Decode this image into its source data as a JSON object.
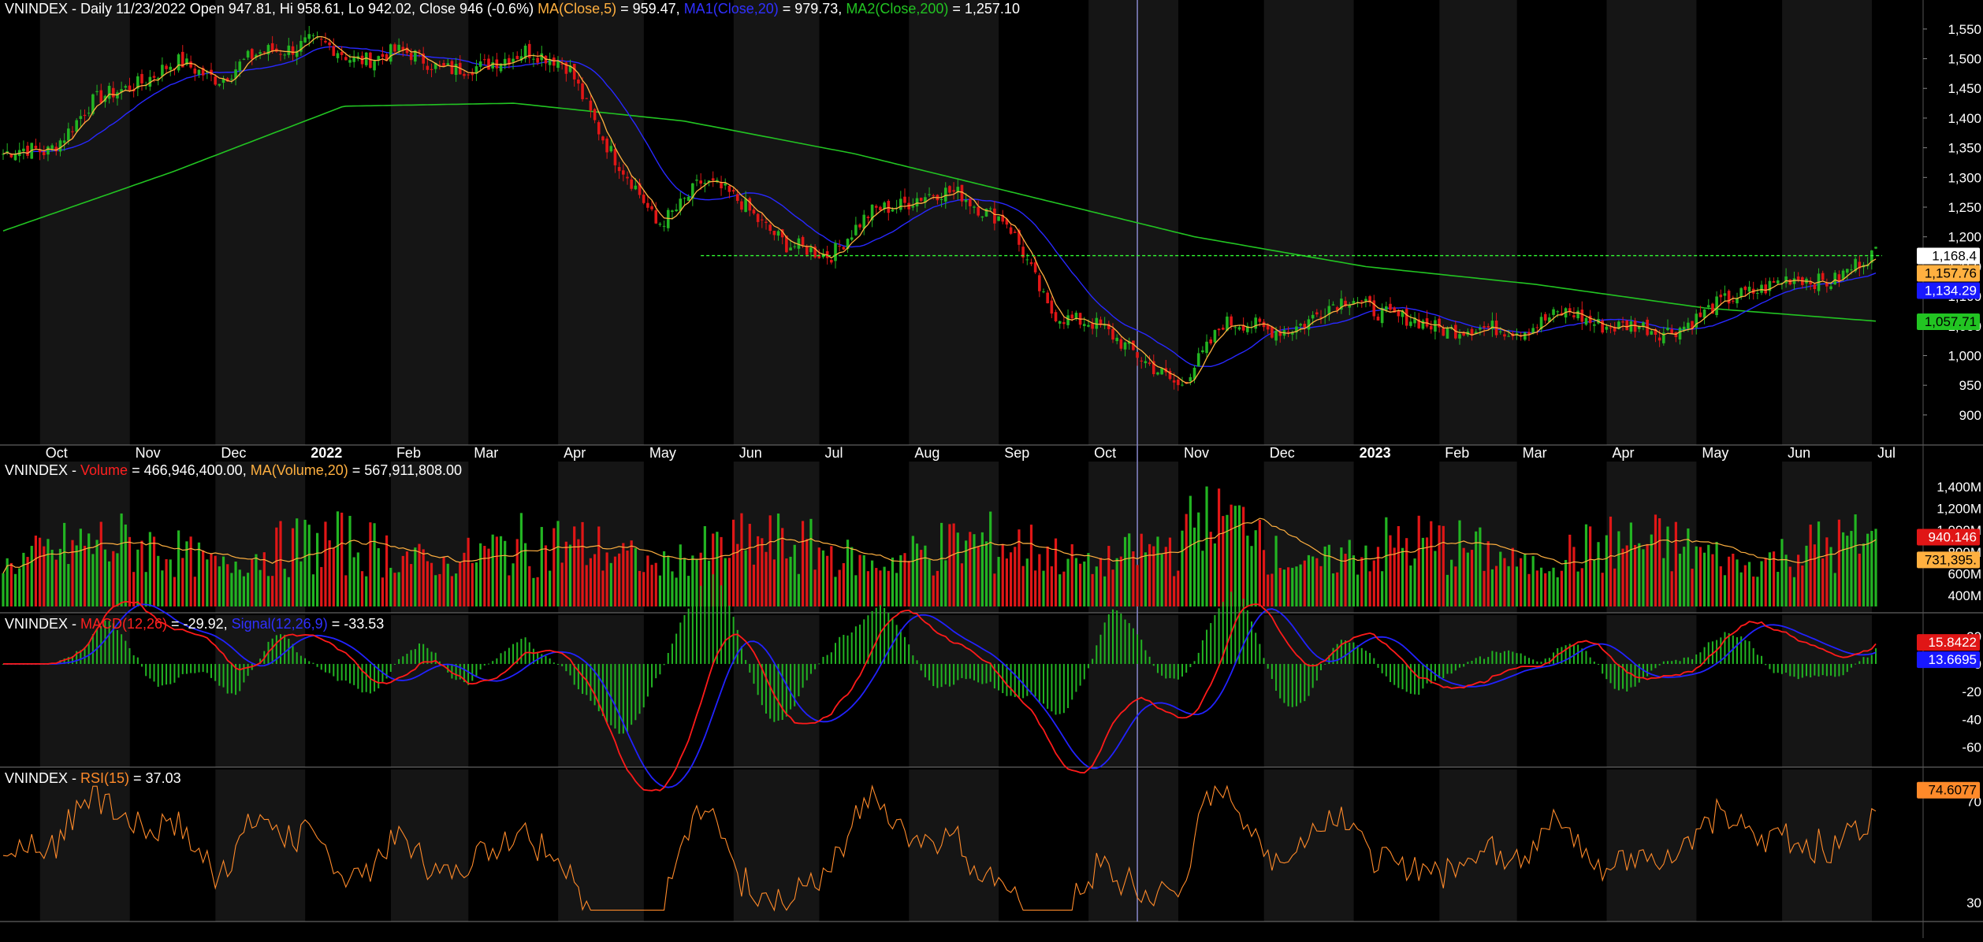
{
  "colors": {
    "background": "#000000",
    "band": "#151515",
    "up": "#22b422",
    "down": "#e01616",
    "ma5": "#ffb040",
    "ma20": "#2828ff",
    "ma200": "#22c422",
    "macd": "#ff1a1a",
    "signal": "#2222ff",
    "rsi": "#ff8a2a",
    "cursor": "#8888cc",
    "support": "#33ff33"
  },
  "header": {
    "price": {
      "prefix": "VNINDEX - Daily 11/23/2022 Open 947.81, Hi 958.61, Lo 942.02, Close 946 (-0.6%) ",
      "ma5_label": "MA(Close,5)",
      "ma5_value": " = 959.47, ",
      "ma20_label": "MA1(Close,20)",
      "ma20_value": " = 979.73, ",
      "ma200_label": "MA2(Close,200)",
      "ma200_value": " = 1,257.10"
    },
    "volume": {
      "prefix": "VNINDEX - ",
      "vol_label": "Volume",
      "vol_value": " = 466,946,400.00, ",
      "ma_label": "MA(Volume,20)",
      "ma_value": " = 567,911,808.00"
    },
    "macd": {
      "prefix": "VNINDEX - ",
      "macd_label": "MACD(12,26)",
      "macd_value": " = -29.92, ",
      "signal_label": "Signal(12,26,9)",
      "signal_value": " = -33.53"
    },
    "rsi": {
      "prefix": "VNINDEX - ",
      "rsi_label": "RSI(15)",
      "rsi_value": " = 37.03"
    }
  },
  "chart_data": [
    {
      "type": "candlestick",
      "panel": "price",
      "x_labels": [
        "Oct",
        "Nov",
        "Dec",
        "2022",
        "Feb",
        "Mar",
        "Apr",
        "May",
        "Jun",
        "Jul",
        "Aug",
        "Sep",
        "Oct",
        "Nov",
        "Dec",
        "2023",
        "Feb",
        "Mar",
        "Apr",
        "May",
        "Jun",
        "Jul"
      ],
      "y_ticks": [
        900,
        950,
        1000,
        1050,
        1100,
        1150,
        1200,
        1250,
        1300,
        1350,
        1400,
        1450,
        1500,
        1550
      ],
      "ylim": [
        860,
        1575
      ],
      "price_anchors": [
        [
          "Oct",
          1340
        ],
        [
          "Oct",
          1345
        ],
        [
          "Nov",
          1420
        ],
        [
          "Nov",
          1460
        ],
        [
          "Dec",
          1490
        ],
        [
          "Dec",
          1470
        ],
        [
          "2022",
          1510
        ],
        [
          "2022",
          1530
        ],
        [
          "Feb",
          1500
        ],
        [
          "Feb",
          1510
        ],
        [
          "Mar",
          1490
        ],
        [
          "Mar",
          1480
        ],
        [
          "Apr",
          1520
        ],
        [
          "Apr",
          1480
        ],
        [
          "May",
          1340
        ],
        [
          "May",
          1220
        ],
        [
          "Jun",
          1290
        ],
        [
          "Jun",
          1260
        ],
        [
          "Jul",
          1180
        ],
        [
          "Jul",
          1175
        ],
        [
          "Aug",
          1240
        ],
        [
          "Aug",
          1270
        ],
        [
          "Sep",
          1270
        ],
        [
          "Sep",
          1230
        ],
        [
          "Oct",
          1080
        ],
        [
          "Oct",
          1050
        ],
        [
          "Nov",
          1010
        ],
        [
          "Nov",
          940
        ],
        [
          "Dec",
          1060
        ],
        [
          "Dec",
          1040
        ],
        [
          "2023",
          1060
        ],
        [
          "2023",
          1100
        ],
        [
          "Feb",
          1060
        ],
        [
          "Feb",
          1050
        ],
        [
          "Mar",
          1040
        ],
        [
          "Mar",
          1050
        ],
        [
          "Apr",
          1070
        ],
        [
          "Apr",
          1050
        ],
        [
          "May",
          1040
        ],
        [
          "May",
          1065
        ],
        [
          "Jun",
          1110
        ],
        [
          "Jun",
          1125
        ],
        [
          "Jul",
          1130
        ],
        [
          "Jul",
          1168
        ]
      ],
      "ma200_anchors": [
        [
          "Oct",
          1210
        ],
        [
          "Dec",
          1310
        ],
        [
          "Apr",
          1420
        ],
        [
          "May",
          1425
        ],
        [
          "Aug",
          1395
        ],
        [
          "Oct",
          1340
        ],
        [
          "Nov",
          1270
        ],
        [
          "Dec",
          1200
        ],
        [
          "2023",
          1150
        ],
        [
          "Mar",
          1120
        ],
        [
          "May",
          1080
        ],
        [
          "Jul",
          1058
        ]
      ],
      "support_level": 1168.4,
      "right_labels": [
        {
          "text": "1,168.4",
          "value": 1168.4,
          "bg": "#ffffff",
          "fg": "#000000"
        },
        {
          "text": "1,157.76",
          "value": 1157.76,
          "bg": "#ffb040",
          "fg": "#000000"
        },
        {
          "text": "1,134.29",
          "value": 1134.29,
          "bg": "#1818ff",
          "fg": "#ffffff"
        },
        {
          "text": "1,057.71",
          "value": 1057.71,
          "bg": "#22c422",
          "fg": "#000000"
        }
      ]
    },
    {
      "type": "bar",
      "panel": "volume",
      "y_ticks": [
        {
          "v": 400,
          "t": "400M"
        },
        {
          "v": 600,
          "t": "600M"
        },
        {
          "v": 800,
          "t": "800M"
        },
        {
          "v": 1000,
          "t": "1,000M"
        },
        {
          "v": 1200,
          "t": "1,200M"
        },
        {
          "v": 1400,
          "t": "1,400M"
        }
      ],
      "ylim": [
        300,
        1500
      ],
      "units": "M",
      "right_labels": [
        {
          "text": "940.146",
          "value": 940,
          "bg": "#e01616",
          "fg": "#ffffff"
        },
        {
          "text": "731,395.",
          "value": 731,
          "bg": "#ffb040",
          "fg": "#000000"
        }
      ]
    },
    {
      "type": "line",
      "panel": "macd",
      "series": [
        "MACD(12,26)",
        "Signal(12,26,9)"
      ],
      "y_ticks": [
        -60,
        -40,
        -20,
        0,
        20
      ],
      "ylim": [
        -70,
        25
      ],
      "right_labels": [
        {
          "text": "15.8422",
          "value": 15.8,
          "bg": "#e01616",
          "fg": "#ffffff"
        },
        {
          "text": "13.6695",
          "value": 13.67,
          "bg": "#1818ff",
          "fg": "#ffffff"
        }
      ]
    },
    {
      "type": "line",
      "panel": "rsi",
      "series": [
        "RSI(15)"
      ],
      "y_ticks": [
        30,
        70
      ],
      "ylim": [
        25,
        77
      ],
      "right_labels": [
        {
          "text": "74.6077",
          "value": 74.6,
          "bg": "#ff8a2a",
          "fg": "#000000"
        }
      ]
    }
  ]
}
